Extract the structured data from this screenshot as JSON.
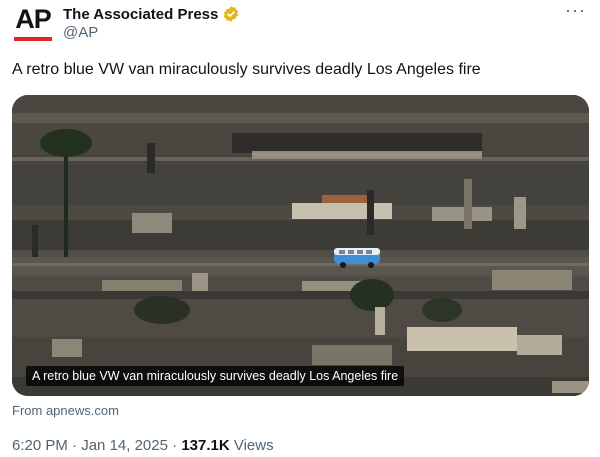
{
  "account": {
    "logo_text": "AP",
    "display_name": "The Associated Press",
    "handle": "@AP",
    "verified_icon": "verified-badge-icon",
    "verified_color": "#e2b719",
    "brand_red": "#e0262b"
  },
  "menu": {
    "more_label": "···"
  },
  "tweet": {
    "text": "A retro blue VW van miraculously survives deadly Los Angeles fire",
    "image_caption": "A retro blue VW van miraculously survives deadly Los Angeles fire",
    "link_source": "From apnews.com"
  },
  "meta": {
    "time": "6:20 PM",
    "separator": " · ",
    "date": "Jan 14, 2025",
    "separator2": " · ",
    "views_count": "137.1K",
    "views_label": " Views"
  },
  "colors": {
    "text_primary": "#0f1419",
    "text_secondary": "#536471",
    "van_blue": "#3f8fd6"
  }
}
